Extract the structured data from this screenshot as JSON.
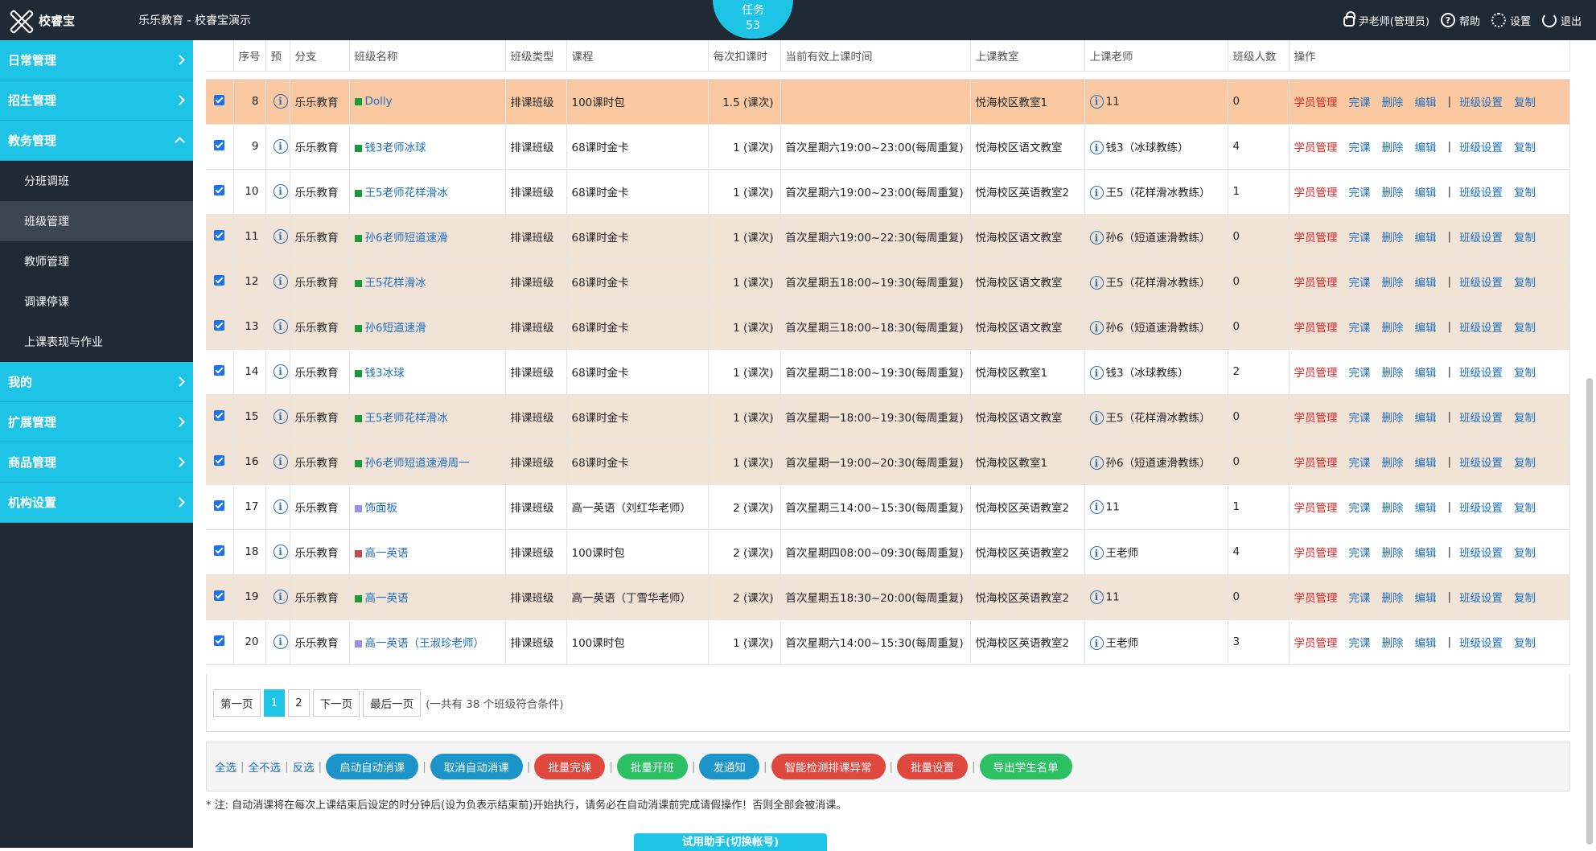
{
  "app": {
    "logo_text": "校睿宝",
    "org_title": "乐乐教育 - 校睿宝演示"
  },
  "task": {
    "label": "任务",
    "count": "53"
  },
  "top_right": {
    "user": "尹老师(管理员)",
    "help": "帮助",
    "settings": "设置",
    "logout": "退出"
  },
  "sidebar": {
    "main_items": [
      "日常管理",
      "招生管理",
      "教务管理"
    ],
    "sub_items": [
      "分班调班",
      "班级管理",
      "教师管理",
      "调课停课",
      "上课表现与作业"
    ],
    "tail_items": [
      "我的",
      "扩展管理",
      "商品管理",
      "机构设置"
    ]
  },
  "table": {
    "headers": [
      "序号",
      "预",
      "分支",
      "班级名称",
      "班级类型",
      "课程",
      "每次扣课时",
      "当前有效上课时间",
      "上课教室",
      "上课老师",
      "班级人数",
      "操作"
    ],
    "ops": [
      "学员管理",
      "完课",
      "删除",
      "编辑",
      "班级设置",
      "复制"
    ],
    "rows": [
      {
        "no": "8",
        "branch": "乐乐教育",
        "name": "Dolly",
        "color": "#1a9a3a",
        "type": "排课班级",
        "course": "100课时包",
        "per": "1.5 (课次)",
        "time": "",
        "room": "悦海校区教室1",
        "teacher": "11",
        "count": "0",
        "style": "hl"
      },
      {
        "no": "9",
        "branch": "乐乐教育",
        "name": "钱3老师冰球",
        "color": "#1a9a3a",
        "type": "排课班级",
        "course": "68课时金卡",
        "per": "1 (课次)",
        "time": "首次星期六19:00~23:00(每周重复)",
        "room": "悦海校区语文教室",
        "teacher": "钱3（冰球教练）",
        "count": "4",
        "style": "plain"
      },
      {
        "no": "10",
        "branch": "乐乐教育",
        "name": "王5老师花样滑冰",
        "color": "#1a9a3a",
        "type": "排课班级",
        "course": "68课时金卡",
        "per": "1 (课次)",
        "time": "首次星期六19:00~23:00(每周重复)",
        "room": "悦海校区英语教室2",
        "teacher": "王5（花样滑冰教练）",
        "count": "1",
        "style": "plain"
      },
      {
        "no": "11",
        "branch": "乐乐教育",
        "name": "孙6老师短道速滑",
        "color": "#1a9a3a",
        "type": "排课班级",
        "course": "68课时金卡",
        "per": "1 (课次)",
        "time": "首次星期六19:00~22:30(每周重复)",
        "room": "悦海校区语文教室",
        "teacher": "孙6（短道速滑教练）",
        "count": "0",
        "style": "alt"
      },
      {
        "no": "12",
        "branch": "乐乐教育",
        "name": "王5花样滑冰",
        "color": "#1a9a3a",
        "type": "排课班级",
        "course": "68课时金卡",
        "per": "1 (课次)",
        "time": "首次星期五18:00~19:30(每周重复)",
        "room": "悦海校区语文教室",
        "teacher": "王5（花样滑冰教练）",
        "count": "0",
        "style": "alt"
      },
      {
        "no": "13",
        "branch": "乐乐教育",
        "name": "孙6短道速滑",
        "color": "#1a9a3a",
        "type": "排课班级",
        "course": "68课时金卡",
        "per": "1 (课次)",
        "time": "首次星期三18:00~18:30(每周重复)",
        "room": "悦海校区语文教室",
        "teacher": "孙6（短道速滑教练）",
        "count": "0",
        "style": "alt"
      },
      {
        "no": "14",
        "branch": "乐乐教育",
        "name": "钱3冰球",
        "color": "#1a9a3a",
        "type": "排课班级",
        "course": "68课时金卡",
        "per": "1 (课次)",
        "time": "首次星期二18:00~19:30(每周重复)",
        "room": "悦海校区教室1",
        "teacher": "钱3（冰球教练）",
        "count": "2",
        "style": "plain"
      },
      {
        "no": "15",
        "branch": "乐乐教育",
        "name": "王5老师花样滑冰",
        "color": "#1a9a3a",
        "type": "排课班级",
        "course": "68课时金卡",
        "per": "1 (课次)",
        "time": "首次星期一18:00~19:30(每周重复)",
        "room": "悦海校区语文教室",
        "teacher": "王5（花样滑冰教练）",
        "count": "0",
        "style": "alt"
      },
      {
        "no": "16",
        "branch": "乐乐教育",
        "name": "孙6老师短道速滑周一",
        "color": "#1a9a3a",
        "type": "排课班级",
        "course": "68课时金卡",
        "per": "1 (课次)",
        "time": "首次星期一19:00~20:30(每周重复)",
        "room": "悦海校区教室1",
        "teacher": "孙6（短道速滑教练）",
        "count": "0",
        "style": "alt"
      },
      {
        "no": "17",
        "branch": "乐乐教育",
        "name": "饰面板",
        "color": "#9b8fe6",
        "type": "排课班级",
        "course": "高一英语（刘红华老师）",
        "per": "2 (课次)",
        "time": "首次星期三14:00~15:30(每周重复)",
        "room": "悦海校区英语教室2",
        "teacher": "11",
        "count": "1",
        "style": "plain"
      },
      {
        "no": "18",
        "branch": "乐乐教育",
        "name": "高一英语",
        "color": "#c94a4a",
        "type": "排课班级",
        "course": "100课时包",
        "per": "2 (课次)",
        "time": "首次星期四08:00~09:30(每周重复)",
        "room": "悦海校区英语教室2",
        "teacher": "王老师",
        "count": "4",
        "style": "plain"
      },
      {
        "no": "19",
        "branch": "乐乐教育",
        "name": "高一英语",
        "color": "#1a9a3a",
        "type": "排课班级",
        "course": "高一英语（丁雪华老师）",
        "per": "2 (课次)",
        "time": "首次星期五18:30~20:00(每周重复)",
        "room": "悦海校区英语教室2",
        "teacher": "11",
        "count": "0",
        "style": "alt"
      },
      {
        "no": "20",
        "branch": "乐乐教育",
        "name": "高一英语（王淑珍老师）",
        "color": "#9b8fe6",
        "type": "排课班级",
        "course": "100课时包",
        "per": "1 (课次)",
        "time": "首次星期六14:00~15:30(每周重复)",
        "room": "悦海校区英语教室2",
        "teacher": "王老师",
        "count": "3",
        "style": "plain"
      }
    ]
  },
  "pager": {
    "first": "第一页",
    "p1": "1",
    "p2": "2",
    "next": "下一页",
    "last": "最后一页",
    "summary": "(一共有 38 个班级符合条件)"
  },
  "actions": {
    "select_all": "全选",
    "select_none": "全不选",
    "invert": "反选",
    "buttons": [
      {
        "label": "启动自动消课",
        "color": "blue"
      },
      {
        "label": "取消自动消课",
        "color": "blue"
      },
      {
        "label": "批量完课",
        "color": "red"
      },
      {
        "label": "批量开班",
        "color": "green"
      },
      {
        "label": "发通知",
        "color": "blue"
      },
      {
        "label": "智能检测排课异常",
        "color": "red"
      },
      {
        "label": "批量设置",
        "color": "red"
      },
      {
        "label": "导出学生名单",
        "color": "green"
      }
    ]
  },
  "note": "* 注:  自动消课将在每次上课结束后设定的时分钟后(设为负表示结束前)开始执行，请务必在自动消课前完成请假操作！否则全部会被消课。",
  "helper": "试用助手(切换帐号)",
  "colors": {
    "accent": "#1ec4e6",
    "dark": "#1f2a35",
    "highlight_row": "#fac9a1",
    "alt_row": "#f2e3d7",
    "link": "#1e6fc4",
    "danger": "#e02020"
  }
}
